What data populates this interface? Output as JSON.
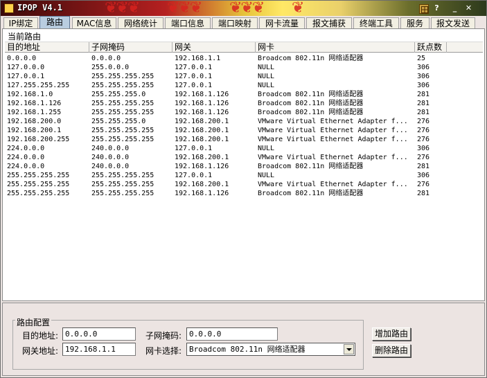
{
  "titlebar": {
    "title": "IPOP V4.1",
    "help": "?",
    "minimize": "_",
    "close": "✕"
  },
  "tabs": [
    {
      "label": "IP绑定"
    },
    {
      "label": "路由"
    },
    {
      "label": "MAC信息"
    },
    {
      "label": "网络统计"
    },
    {
      "label": "端口信息"
    },
    {
      "label": "端口映射"
    },
    {
      "label": "网卡流量"
    },
    {
      "label": "报文捕获"
    },
    {
      "label": "终端工具"
    },
    {
      "label": "服务"
    },
    {
      "label": "报文发送"
    }
  ],
  "routes": {
    "section_label": "当前路由",
    "columns": [
      "目的地址",
      "子网掩码",
      "网关",
      "网卡",
      "跃点数"
    ],
    "rows": [
      [
        "0.0.0.0",
        "0.0.0.0",
        "192.168.1.1",
        "Broadcom 802.11n 网络适配器",
        "25"
      ],
      [
        "127.0.0.0",
        "255.0.0.0",
        "127.0.0.1",
        "NULL",
        "306"
      ],
      [
        "127.0.0.1",
        "255.255.255.255",
        "127.0.0.1",
        "NULL",
        "306"
      ],
      [
        "127.255.255.255",
        "255.255.255.255",
        "127.0.0.1",
        "NULL",
        "306"
      ],
      [
        "192.168.1.0",
        "255.255.255.0",
        "192.168.1.126",
        "Broadcom 802.11n 网络适配器",
        "281"
      ],
      [
        "192.168.1.126",
        "255.255.255.255",
        "192.168.1.126",
        "Broadcom 802.11n 网络适配器",
        "281"
      ],
      [
        "192.168.1.255",
        "255.255.255.255",
        "192.168.1.126",
        "Broadcom 802.11n 网络适配器",
        "281"
      ],
      [
        "192.168.200.0",
        "255.255.255.0",
        "192.168.200.1",
        "VMware Virtual Ethernet Adapter f...",
        "276"
      ],
      [
        "192.168.200.1",
        "255.255.255.255",
        "192.168.200.1",
        "VMware Virtual Ethernet Adapter f...",
        "276"
      ],
      [
        "192.168.200.255",
        "255.255.255.255",
        "192.168.200.1",
        "VMware Virtual Ethernet Adapter f...",
        "276"
      ],
      [
        "224.0.0.0",
        "240.0.0.0",
        "127.0.0.1",
        "NULL",
        "306"
      ],
      [
        "224.0.0.0",
        "240.0.0.0",
        "192.168.200.1",
        "VMware Virtual Ethernet Adapter f...",
        "276"
      ],
      [
        "224.0.0.0",
        "240.0.0.0",
        "192.168.1.126",
        "Broadcom 802.11n 网络适配器",
        "281"
      ],
      [
        "255.255.255.255",
        "255.255.255.255",
        "127.0.0.1",
        "NULL",
        "306"
      ],
      [
        "255.255.255.255",
        "255.255.255.255",
        "192.168.200.1",
        "VMware Virtual Ethernet Adapter f...",
        "276"
      ],
      [
        "255.255.255.255",
        "255.255.255.255",
        "192.168.1.126",
        "Broadcom 802.11n 网络适配器",
        "281"
      ]
    ]
  },
  "config": {
    "group_title": "路由配置",
    "dest_label": "目的地址:",
    "dest_value": "0.0.0.0",
    "mask_label": "子网掩码:",
    "mask_value": "0.0.0.0",
    "gateway_label": "网关地址:",
    "gateway_value": "192.168.1.1",
    "nic_label": "网卡选择:",
    "nic_value": "Broadcom 802.11n 网络适配器",
    "add_button": "增加路由",
    "delete_button": "删除路由"
  }
}
